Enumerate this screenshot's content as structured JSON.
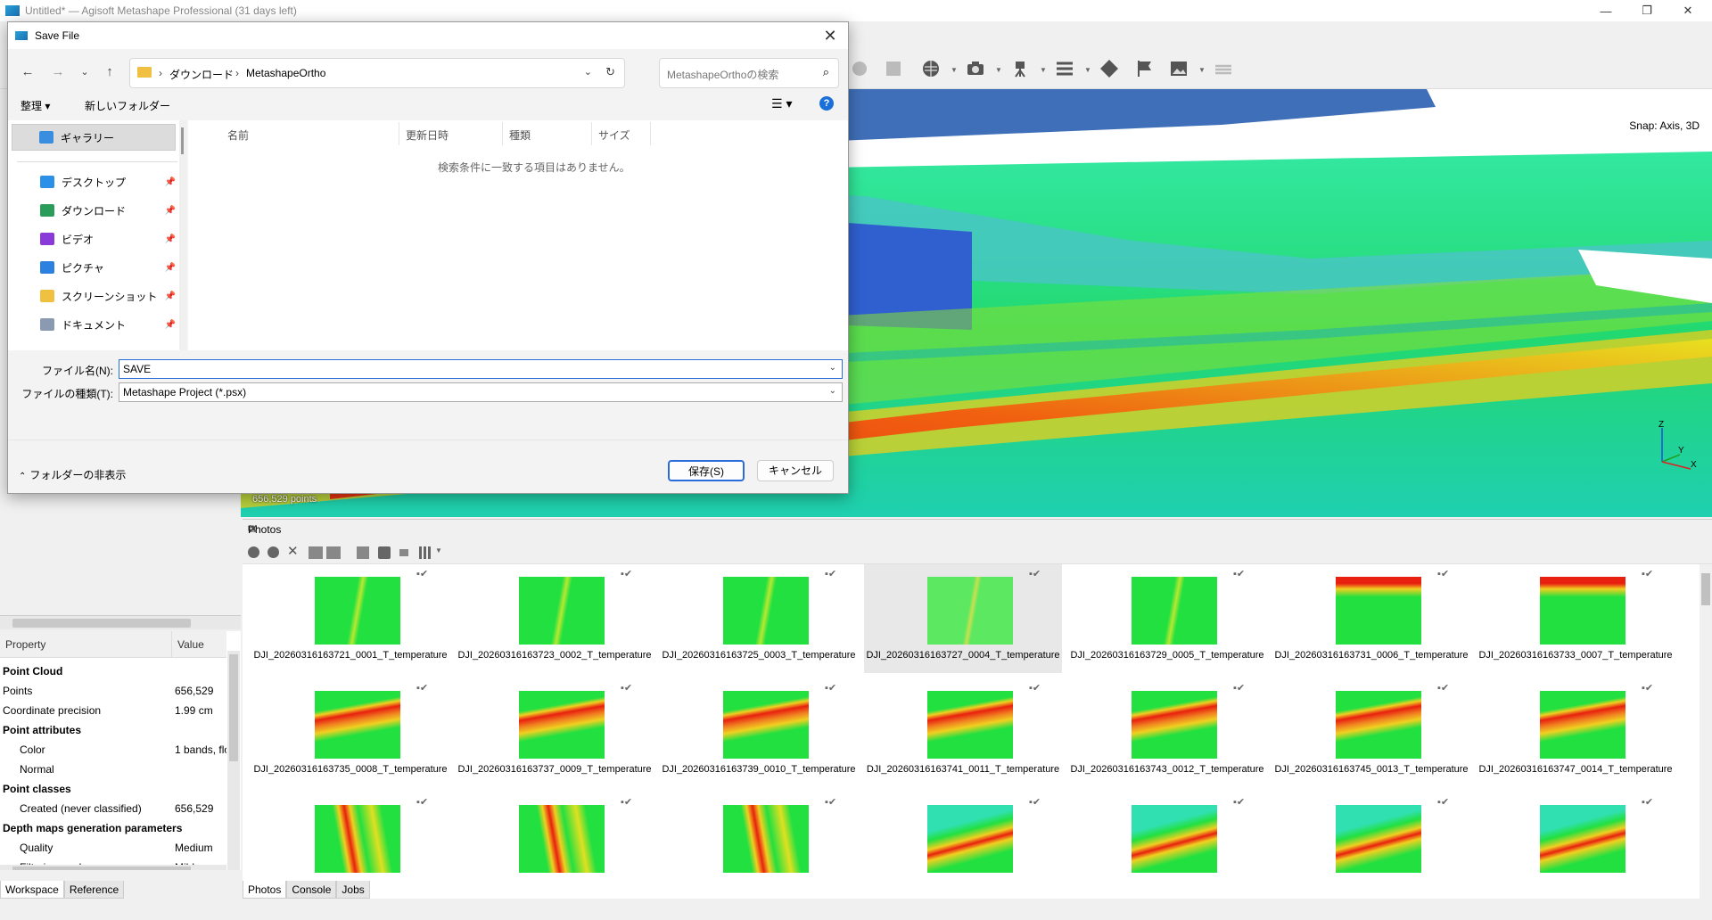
{
  "app": {
    "title": "Untitled* — Agisoft Metashape Professional (31 days left)",
    "snap": "Snap: Axis, 3D",
    "point_count": "656,529 points",
    "axis_z": "Z",
    "axis_y": "Y",
    "axis_x": "X"
  },
  "properties": {
    "col_property": "Property",
    "col_value": "Value",
    "rows": [
      {
        "k": "Point Cloud",
        "v": "",
        "group": true
      },
      {
        "k": "Points",
        "v": "656,529"
      },
      {
        "k": "Coordinate precision",
        "v": "1.99 cm"
      },
      {
        "k": "Point attributes",
        "v": "",
        "group": true
      },
      {
        "k": "Color",
        "v": "1 bands, flo",
        "indent": true
      },
      {
        "k": "Normal",
        "v": "",
        "indent": true
      },
      {
        "k": "Point classes",
        "v": "",
        "group": true
      },
      {
        "k": "Created (never classified)",
        "v": "656,529",
        "indent": true
      },
      {
        "k": "Depth maps generation parameters",
        "v": "",
        "group": true
      },
      {
        "k": "Quality",
        "v": "Medium",
        "indent": true
      },
      {
        "k": "Filtering mode",
        "v": "Mild",
        "indent": true
      }
    ]
  },
  "left_tabs": [
    "Workspace",
    "Reference"
  ],
  "bottom_tabs": [
    "Photos",
    "Console",
    "Jobs"
  ],
  "photos": {
    "title": "Photos",
    "items": [
      "DJI_20260316163721_0001_T_temperature",
      "DJI_20260316163723_0002_T_temperature",
      "DJI_20260316163725_0003_T_temperature",
      "DJI_20260316163727_0004_T_temperature",
      "DJI_20260316163729_0005_T_temperature",
      "DJI_20260316163731_0006_T_temperature",
      "DJI_20260316163733_0007_T_temperature",
      "DJI_20260316163735_0008_T_temperature",
      "DJI_20260316163737_0009_T_temperature",
      "DJI_20260316163739_0010_T_temperature",
      "DJI_20260316163741_0011_T_temperature",
      "DJI_20260316163743_0012_T_temperature",
      "DJI_20260316163745_0013_T_temperature",
      "DJI_20260316163747_0014_T_temperature",
      "",
      "",
      "",
      "",
      "",
      "",
      ""
    ],
    "selected_index": 3
  },
  "dialog": {
    "title": "Save File",
    "breadcrumb": [
      "ダウンロード",
      "MetashapeOrtho"
    ],
    "search_placeholder": "MetashapeOrthoの検索",
    "organize": "整理 ▾",
    "new_folder": "新しいフォルダー",
    "nav": [
      {
        "label": "ギャラリー",
        "icon": "gallery-icon"
      },
      {
        "label": "デスクトップ",
        "icon": "desktop-icon"
      },
      {
        "label": "ダウンロード",
        "icon": "download-icon"
      },
      {
        "label": "ビデオ",
        "icon": "video-icon"
      },
      {
        "label": "ピクチャ",
        "icon": "pictures-icon"
      },
      {
        "label": "スクリーンショット",
        "icon": "folder-icon"
      },
      {
        "label": "ドキュメント",
        "icon": "documents-icon"
      }
    ],
    "columns": [
      "名前",
      "更新日時",
      "種類",
      "サイズ"
    ],
    "empty_message": "検索条件に一致する項目はありません。",
    "filename_label": "ファイル名(N):",
    "filename_value": "SAVE",
    "filetype_label": "ファイルの種類(T):",
    "filetype_value": "Metashape Project (*.psx)",
    "hide_folders": "フォルダーの非表示",
    "save": "保存(S)",
    "cancel": "キャンセル"
  },
  "colors": {
    "accent": "#2a6cd8",
    "thermal_green": "#22e040",
    "thermal_red": "#e82010"
  }
}
